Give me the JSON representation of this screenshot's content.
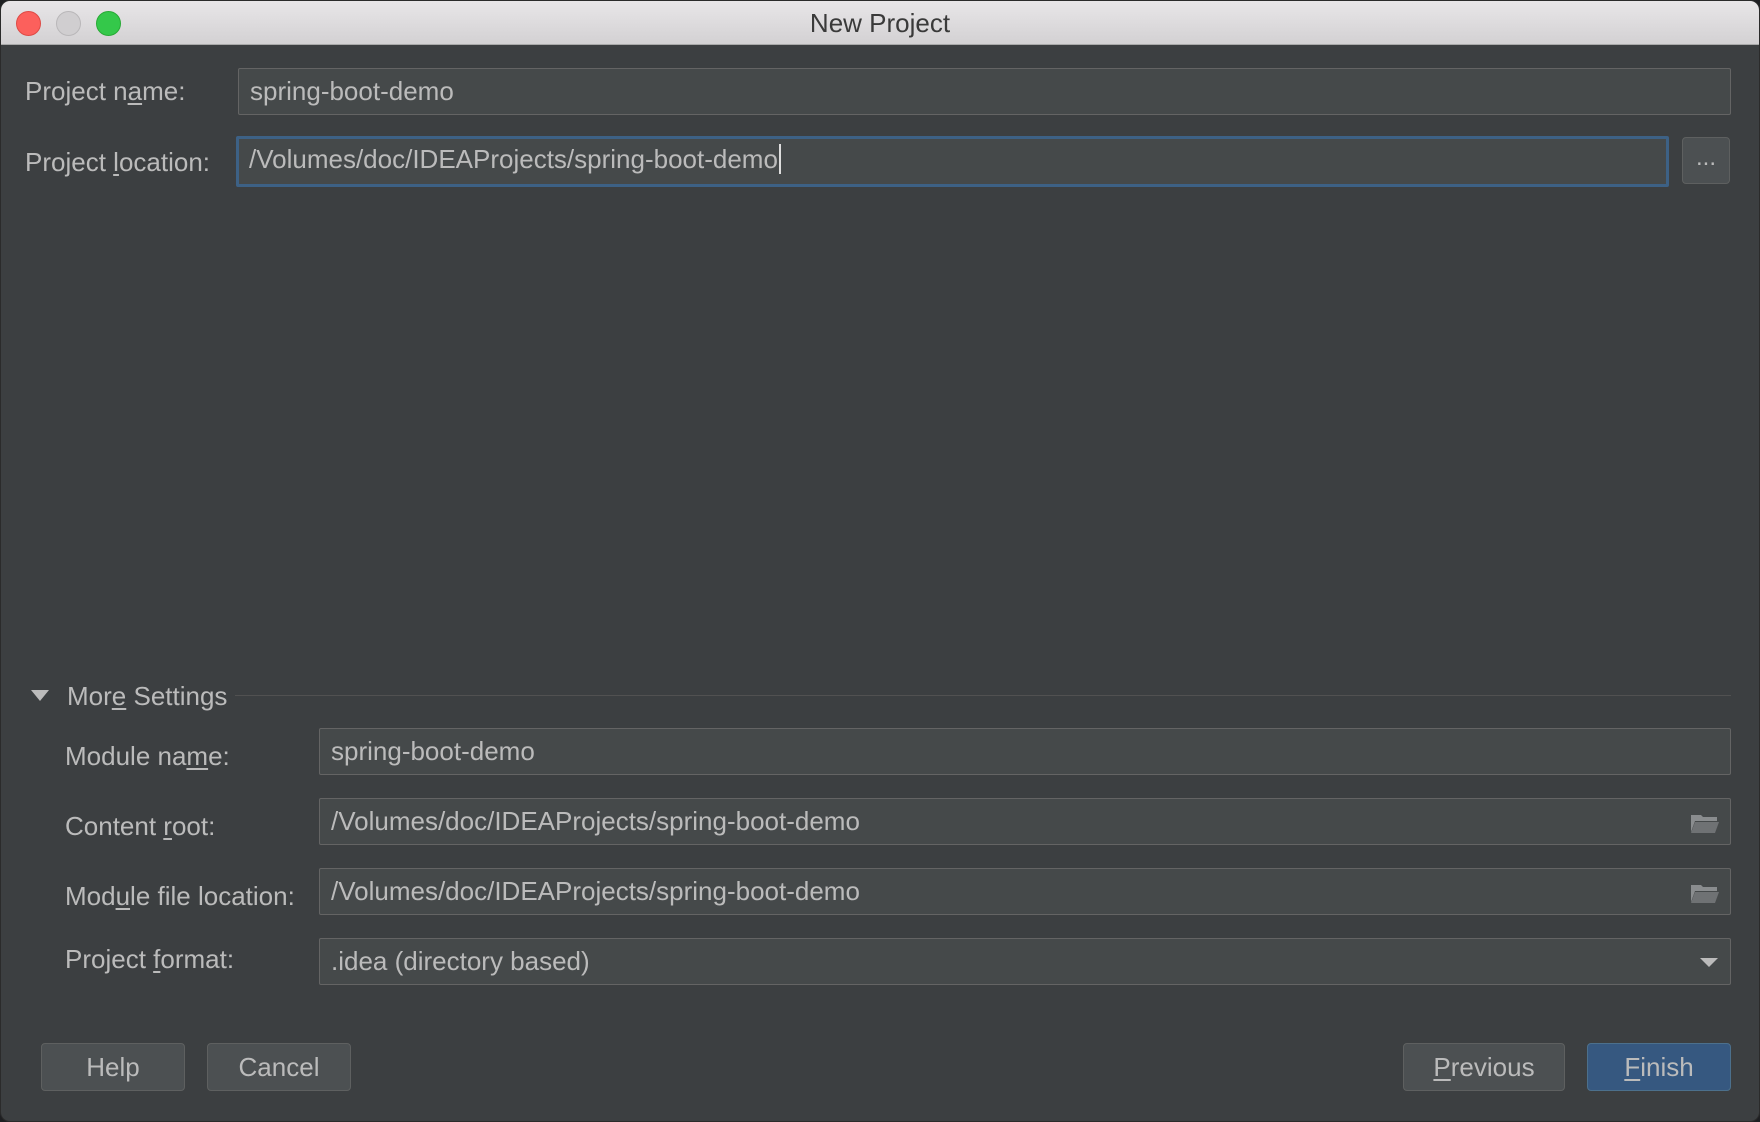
{
  "window": {
    "title": "New Project"
  },
  "form": {
    "project_name_label": "Project name:",
    "project_name_value": "spring-boot-demo",
    "project_location_label": "Project location:",
    "project_location_value": "/Volumes/doc/IDEAProjects/spring-boot-demo",
    "browse_label": "..."
  },
  "more_settings": {
    "header": "More Settings",
    "expanded": true,
    "module_name_label": "Module name:",
    "module_name_value": "spring-boot-demo",
    "content_root_label": "Content root:",
    "content_root_value": "/Volumes/doc/IDEAProjects/spring-boot-demo",
    "module_file_location_label": "Module file location:",
    "module_file_location_value": "/Volumes/doc/IDEAProjects/spring-boot-demo",
    "project_format_label": "Project format:",
    "project_format_value": ".idea (directory based)"
  },
  "buttons": {
    "help": "Help",
    "cancel": "Cancel",
    "previous": "Previous",
    "finish": "Finish"
  },
  "icons": {
    "content_root_browse": "folder-icon",
    "module_file_browse": "folder-icon",
    "format_dropdown": "chevron-down-icon",
    "more_settings_toggle": "triangle-down-icon"
  },
  "colors": {
    "background": "#3c3f41",
    "field": "#45494a",
    "focus_border": "#3d6185",
    "primary_button": "#365880",
    "text": "#bbbbbb"
  }
}
